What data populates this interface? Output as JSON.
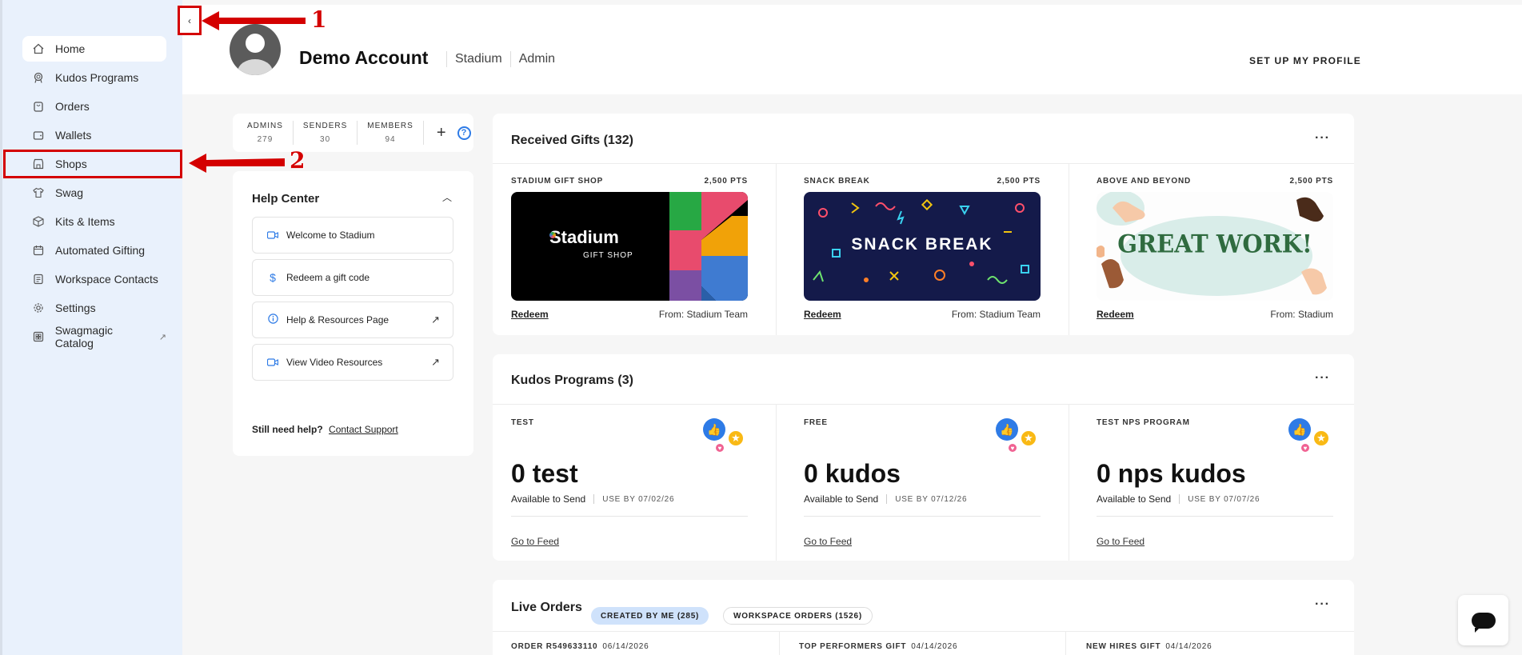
{
  "sidebar": {
    "items": [
      {
        "label": "Home",
        "icon": "home-icon"
      },
      {
        "label": "Kudos Programs",
        "icon": "award-icon"
      },
      {
        "label": "Orders",
        "icon": "bag-icon"
      },
      {
        "label": "Wallets",
        "icon": "wallet-icon"
      },
      {
        "label": "Shops",
        "icon": "store-icon"
      },
      {
        "label": "Swag",
        "icon": "shirt-icon"
      },
      {
        "label": "Kits & Items",
        "icon": "box-icon"
      },
      {
        "label": "Automated Gifting",
        "icon": "calendar-icon"
      },
      {
        "label": "Workspace Contacts",
        "icon": "contacts-icon"
      },
      {
        "label": "Settings",
        "icon": "gear-icon"
      },
      {
        "label": "Swagmagic Catalog",
        "icon": "catalog-icon"
      }
    ],
    "collapse_glyph": "‹"
  },
  "annotations": {
    "one": "1",
    "two": "2"
  },
  "header": {
    "account_name": "Demo Account",
    "org": "Stadium",
    "role": "Admin",
    "setup_label": "SET UP MY PROFILE"
  },
  "counts": [
    {
      "label": "ADMINS",
      "value": "279"
    },
    {
      "label": "SENDERS",
      "value": "30"
    },
    {
      "label": "MEMBERS",
      "value": "94"
    }
  ],
  "help_center": {
    "title": "Help Center",
    "items": [
      {
        "label": "Welcome to Stadium",
        "icon": "video-icon"
      },
      {
        "label": "Redeem a gift code",
        "icon": "dollar-icon"
      },
      {
        "label": "Help & Resources Page",
        "icon": "info-icon"
      },
      {
        "label": "View Video Resources",
        "icon": "video-icon"
      }
    ],
    "footer_question": "Still need help?",
    "footer_link": "Contact Support"
  },
  "received_gifts": {
    "title": "Received Gifts (132)",
    "gifts": [
      {
        "name": "STADIUM GIFT SHOP",
        "points": "2,500 PTS",
        "redeem": "Redeem",
        "from": "From: Stadium Team",
        "image_text": "Stadium",
        "image_subtext": "GIFT SHOP"
      },
      {
        "name": "SNACK BREAK",
        "points": "2,500 PTS",
        "redeem": "Redeem",
        "from": "From: Stadium Team",
        "image_text": "SNACK BREAK"
      },
      {
        "name": "ABOVE AND BEYOND",
        "points": "2,500 PTS",
        "redeem": "Redeem",
        "from": "From: Stadium",
        "image_text": "GREAT WORK!"
      }
    ]
  },
  "kudos_programs": {
    "title": "Kudos Programs (3)",
    "programs": [
      {
        "name": "TEST",
        "amount": "0 test",
        "available": "Available to Send",
        "use_by": "USE BY 07/02/26",
        "feed": "Go to Feed"
      },
      {
        "name": "FREE",
        "amount": "0 kudos",
        "available": "Available to Send",
        "use_by": "USE BY 07/12/26",
        "feed": "Go to Feed"
      },
      {
        "name": "TEST NPS PROGRAM",
        "amount": "0 nps kudos",
        "available": "Available to Send",
        "use_by": "USE BY 07/07/26",
        "feed": "Go to Feed"
      }
    ]
  },
  "live_orders": {
    "title": "Live Orders",
    "tab_created": "CREATED BY ME (285)",
    "tab_workspace": "WORKSPACE ORDERS (1526)",
    "orders": [
      {
        "name": "ORDER R549633110",
        "date": "06/14/2026"
      },
      {
        "name": "TOP PERFORMERS GIFT",
        "date": "04/14/2026"
      },
      {
        "name": "NEW HIRES GIFT",
        "date": "04/14/2026"
      }
    ]
  },
  "menu_glyph": "···",
  "colors": {
    "accent": "#2e7be6",
    "annotation": "#d40000",
    "sidebar_bg": "#e9f1fc"
  }
}
